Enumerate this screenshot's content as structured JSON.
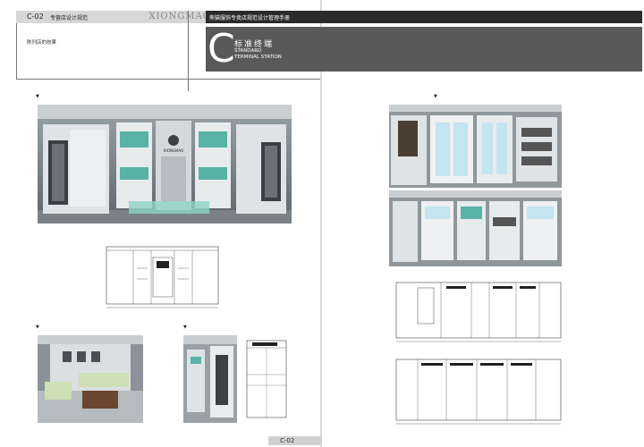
{
  "header_left": {
    "code": "C-02",
    "category": "专营店设计规范",
    "brand": "XIONGMAO"
  },
  "header_right": {
    "title": "熊猫服饰专卖店规范设计管理手册"
  },
  "section": {
    "letter": "C",
    "title_cn": "标准终端",
    "title_en_line1": "STANDARD",
    "title_en_line2": "TERMINAL STATION"
  },
  "effect_label": "陈列店的效果",
  "marker": "▼",
  "storefront_sign": "XIONGMAO 熊猫",
  "counter_logo_text": "XIONGMAO",
  "footer": {
    "page_code": "C-02"
  }
}
